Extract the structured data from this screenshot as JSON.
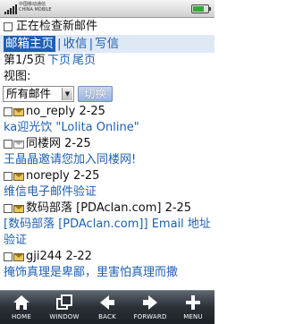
{
  "status_bar": {
    "carrier_line1": "中国移动通信",
    "carrier_line2": "CHINA MOBILE"
  },
  "loading": {
    "text": "正在检查新邮件"
  },
  "nav": {
    "active": "邮箱主页",
    "links": [
      "收信",
      "写信"
    ],
    "separator": "|"
  },
  "pager": {
    "current": "第1/5页",
    "next": "下页",
    "last": "尾页"
  },
  "view": {
    "label": "视图:",
    "selected": "所有邮件",
    "switch_label": "切换"
  },
  "mails": [
    {
      "sender": "no_reply",
      "date": "2-25",
      "subject": "ka迎光饮 \"Lolita Online\"",
      "read": false
    },
    {
      "sender": "同楼网",
      "date": "2-25",
      "subject": "王晶晶邀请您加入同楼网!",
      "read": true
    },
    {
      "sender": "noreply",
      "date": "2-25",
      "subject": "维信电子邮件验证",
      "read": false
    },
    {
      "sender": "数码部落 [PDAclan.com]",
      "date": "2-25",
      "subject": "[数码部落 [PDAclan.com]] Email 地址验证",
      "read": false
    },
    {
      "sender": "gji244",
      "date": "2-22",
      "subject": "掩饰真理是卑鄙，里害怕真理而撒",
      "read": false
    }
  ],
  "toolbar": {
    "home": "HOME",
    "window": "WINDOW",
    "back": "BACK",
    "forward": "FORWARD",
    "menu": "MENU"
  }
}
